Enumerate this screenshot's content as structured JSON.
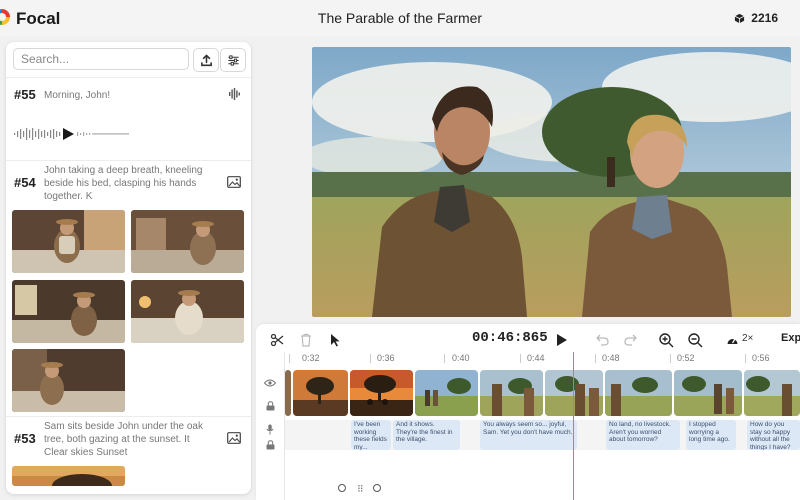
{
  "header": {
    "app_name": "Focal",
    "project_title": "The Parable of the Farmer",
    "credits": "2216",
    "icons": [
      "logo-icon",
      "cube-icon"
    ]
  },
  "sidebar": {
    "search": {
      "placeholder": "Search...",
      "value": ""
    },
    "buttons": [
      "upload-icon",
      "sliders-icon"
    ],
    "scenes": [
      {
        "number": "#55",
        "text": "Morning, John!",
        "type": "audio"
      },
      {
        "number": "#54",
        "text": "John taking a deep breath, kneeling beside his bed, clasping his hands together. K",
        "type": "image",
        "thumbnail_count": 5
      },
      {
        "number": "#53",
        "text": "Sam sits beside John under the oak tree, both gazing at the sunset. It Clear skies Sunset",
        "type": "image"
      }
    ]
  },
  "timeline": {
    "timecode": "00:46:865",
    "speed": "2×",
    "export_label": "Exp",
    "ruler": [
      "0:32",
      "0:36",
      "0:40",
      "0:44",
      "0:48",
      "0:52",
      "0:56"
    ],
    "captions": [
      {
        "text": "I've been working these fields my..."
      },
      {
        "text": "And it shows. They're the finest in the village."
      },
      {
        "text": "You always seem so... joyful, Sam. Yet you don't have much."
      },
      {
        "text": "No land, no livestock. Aren't you worried about tomorrow?"
      },
      {
        "text": "I stopped worrying a long time ago."
      },
      {
        "text": "How do you stay so happy without all the things I have?"
      }
    ]
  },
  "colors": {
    "accent": "#9b7bd8",
    "caption_bg": "#dde8f7"
  }
}
